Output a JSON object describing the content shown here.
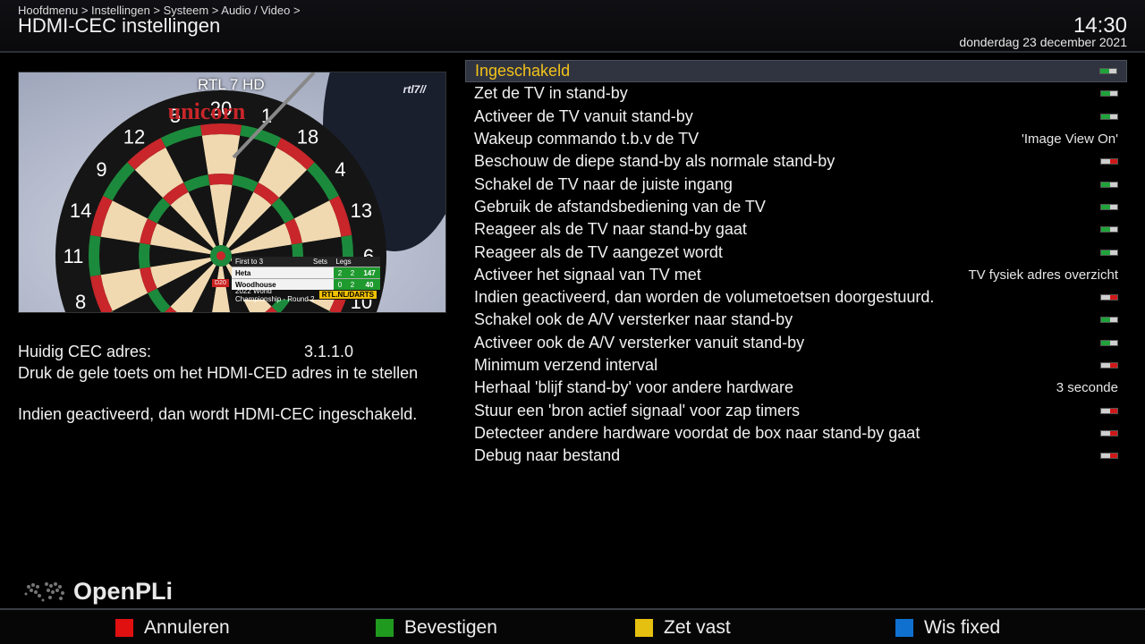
{
  "header": {
    "breadcrumb": "Hoofdmenu > Instellingen > Systeem > Audio / Video >",
    "title": "HDMI-CEC instellingen",
    "time": "14:30",
    "date": "donderdag 23 december 2021"
  },
  "preview": {
    "channel": "RTL 7 HD",
    "channel_logo": "rtl7",
    "board_brand": "unicorn",
    "scoreboard": {
      "header": "First to 3",
      "col_sets": "Sets",
      "col_legs": "Legs",
      "players": [
        {
          "name": "Heta",
          "sets": "2",
          "legs": "2",
          "score": "147"
        },
        {
          "name": "Woodhouse",
          "sets": "0",
          "legs": "2",
          "score": "40"
        }
      ],
      "footer": "2022 World Championship - Round 2",
      "footer_logo": "RTL.NL/DARTS",
      "tag": "D20"
    }
  },
  "info": {
    "address_label": "Huidig CEC adres:",
    "address_value": "3.1.1.0",
    "hint": "Druk de gele toets om het HDMI-CED adres in te stellen",
    "description": "Indien geactiveerd, dan wordt HDMI-CEC ingeschakeld."
  },
  "logo": {
    "text": "OpenPLi",
    "icon": "world-map-icon"
  },
  "settings": [
    {
      "label": "Ingeschakeld",
      "type": "toggle",
      "state": "on",
      "selected": true
    },
    {
      "label": "Zet de TV in stand-by",
      "type": "toggle",
      "state": "on"
    },
    {
      "label": "Activeer de TV vanuit stand-by",
      "type": "toggle",
      "state": "on"
    },
    {
      "label": "Wakeup commando t.b.v de TV",
      "type": "value",
      "value": "'Image View On'"
    },
    {
      "label": "Beschouw de diepe stand-by als normale stand-by",
      "type": "toggle",
      "state": "off"
    },
    {
      "label": "Schakel de TV naar de juiste ingang",
      "type": "toggle",
      "state": "on"
    },
    {
      "label": "Gebruik de afstandsbediening van de TV",
      "type": "toggle",
      "state": "on"
    },
    {
      "label": "Reageer als de TV naar stand-by gaat",
      "type": "toggle",
      "state": "on"
    },
    {
      "label": "Reageer als de TV aangezet wordt",
      "type": "toggle",
      "state": "on"
    },
    {
      "label": "Activeer het signaal van TV met",
      "type": "value",
      "value": "TV fysiek adres overzicht"
    },
    {
      "label": "Indien geactiveerd, dan worden de volumetoetsen doorgestuurd.",
      "type": "toggle",
      "state": "off"
    },
    {
      "label": "Schakel ook de A/V versterker naar stand-by",
      "type": "toggle",
      "state": "on"
    },
    {
      "label": "Activeer ook de A/V versterker vanuit stand-by",
      "type": "toggle",
      "state": "on"
    },
    {
      "label": "Minimum verzend interval",
      "type": "toggle",
      "state": "off"
    },
    {
      "label": "Herhaal 'blijf stand-by' voor andere hardware",
      "type": "value",
      "value": "3 seconde"
    },
    {
      "label": "Stuur een 'bron actief signaal' voor zap timers",
      "type": "toggle",
      "state": "off"
    },
    {
      "label": "Detecteer andere hardware voordat de box naar stand-by gaat",
      "type": "toggle",
      "state": "off"
    },
    {
      "label": "Debug naar bestand",
      "type": "toggle",
      "state": "off"
    }
  ],
  "buttons": [
    {
      "label": "Annuleren",
      "color": "#e01010",
      "name": "cancel"
    },
    {
      "label": "Bevestigen",
      "color": "#1f9a1f",
      "name": "confirm"
    },
    {
      "label": "Zet vast",
      "color": "#e6c010",
      "name": "fix"
    },
    {
      "label": "Wis fixed",
      "color": "#1070d0",
      "name": "clear-fixed"
    }
  ],
  "colors": {
    "selected_text": "#f2c21a",
    "toggle_on": "#1fa33a",
    "toggle_off": "#d01818",
    "selection_bg": "#303440"
  }
}
